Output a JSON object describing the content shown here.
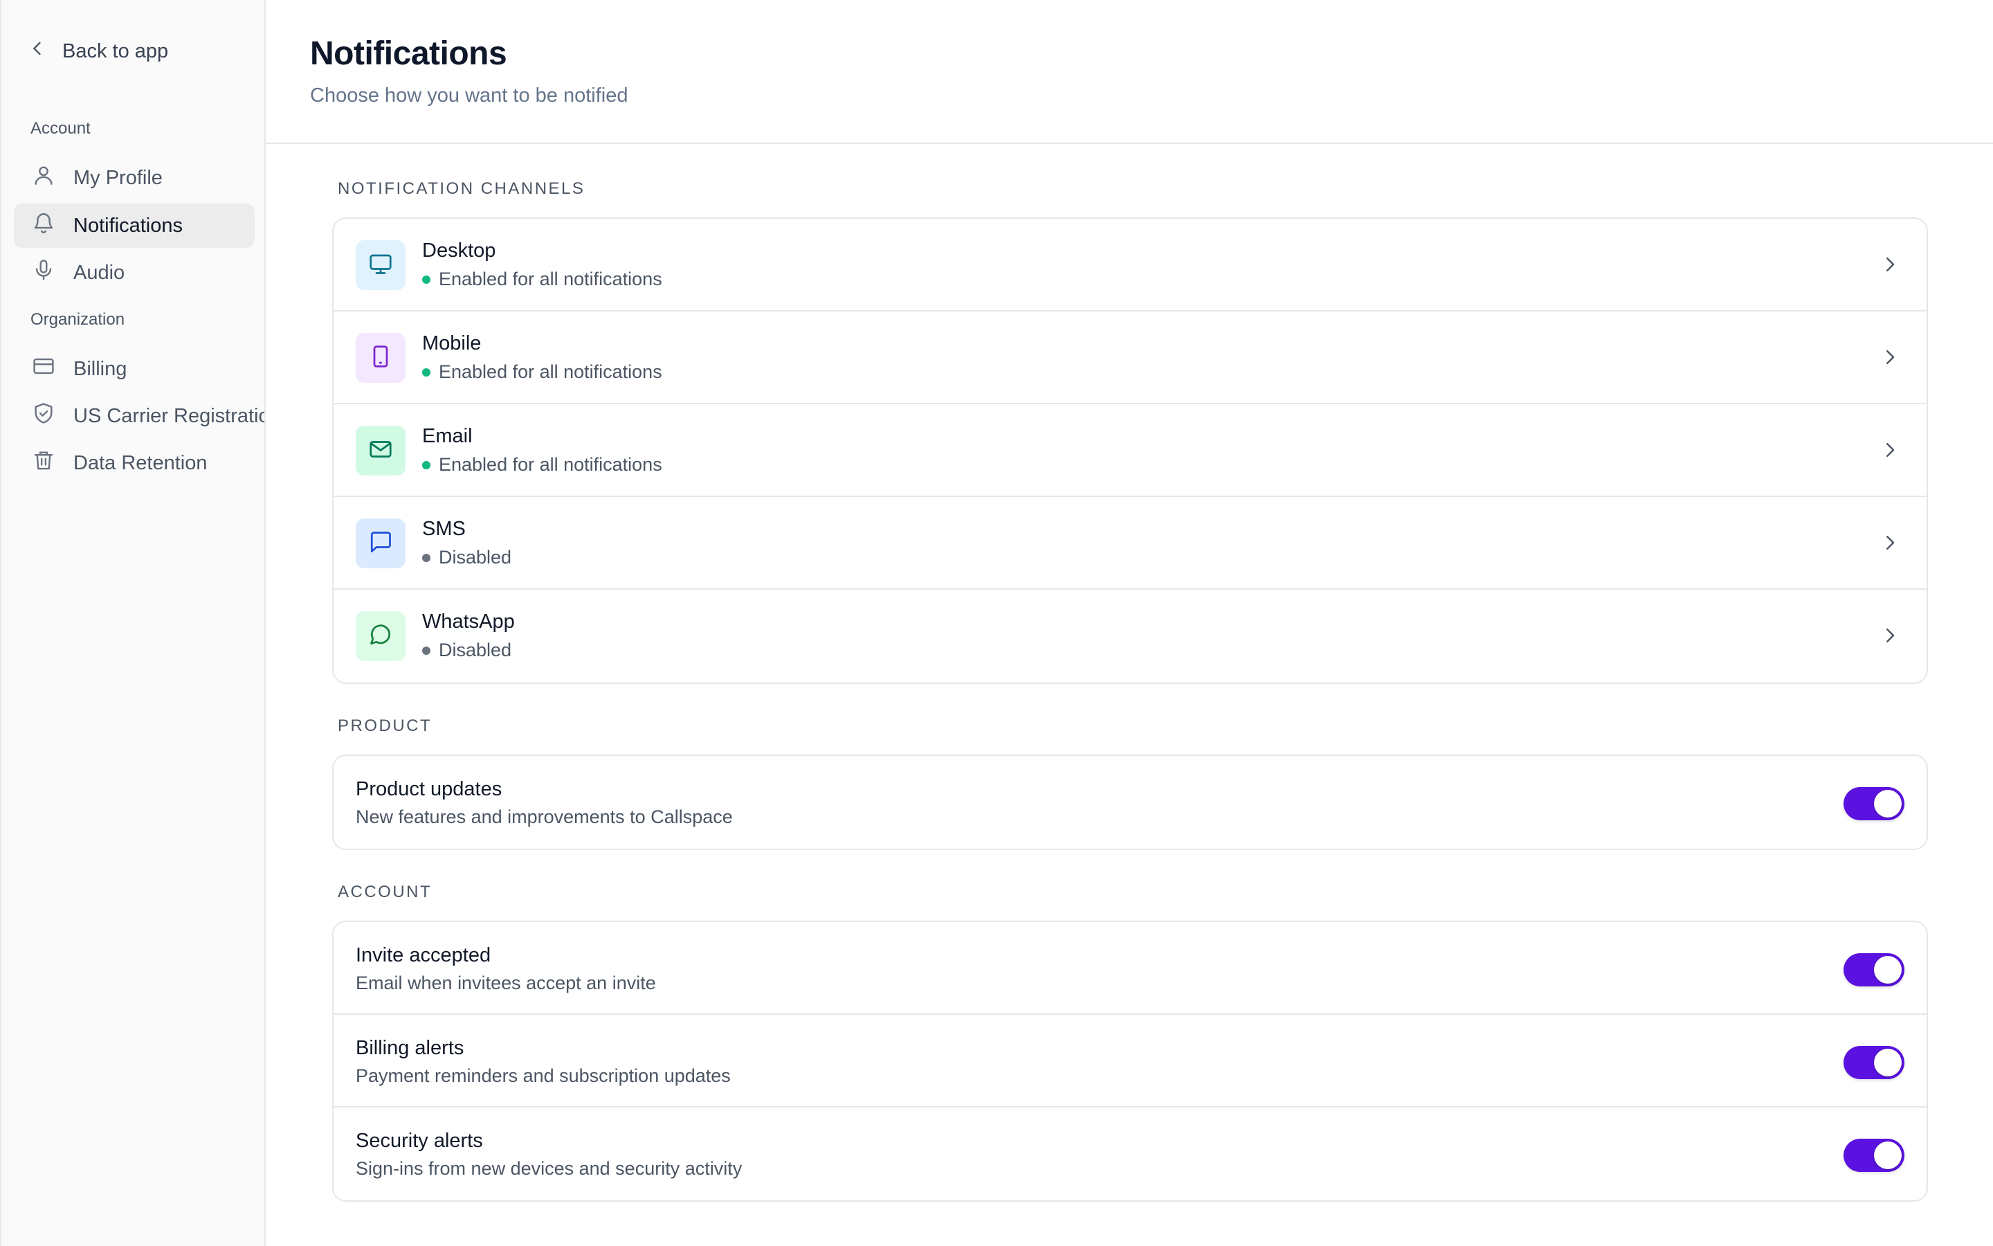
{
  "sidebar": {
    "back_label": "Back to app",
    "account_heading": "Account",
    "organization_heading": "Organization",
    "account_items": [
      {
        "label": "My Profile",
        "icon": "user-icon",
        "active": false
      },
      {
        "label": "Notifications",
        "icon": "bell-icon",
        "active": true
      },
      {
        "label": "Audio",
        "icon": "microphone-icon",
        "active": false
      }
    ],
    "organization_items": [
      {
        "label": "Billing",
        "icon": "credit-card-icon"
      },
      {
        "label": "US Carrier Registration",
        "icon": "shield-check-icon"
      },
      {
        "label": "Data Retention",
        "icon": "trash-icon"
      }
    ]
  },
  "header": {
    "title": "Notifications",
    "subtitle": "Choose how you want to be notified"
  },
  "channels": {
    "heading": "Notification channels",
    "items": [
      {
        "name": "Desktop",
        "status": "Enabled for all notifications",
        "enabled": true,
        "icon": "monitor-icon",
        "icon_color": "#0e7490",
        "icon_bg": "#e0f2fe"
      },
      {
        "name": "Mobile",
        "status": "Enabled for all notifications",
        "enabled": true,
        "icon": "phone-icon",
        "icon_color": "#7e22ce",
        "icon_bg": "#f3e8ff"
      },
      {
        "name": "Email",
        "status": "Enabled for all notifications",
        "enabled": true,
        "icon": "mail-icon",
        "icon_color": "#047857",
        "icon_bg": "#d1fae5"
      },
      {
        "name": "SMS",
        "status": "Disabled",
        "enabled": false,
        "icon": "message-square-icon",
        "icon_color": "#1d4ed8",
        "icon_bg": "#dbeafe"
      },
      {
        "name": "WhatsApp",
        "status": "Disabled",
        "enabled": false,
        "icon": "message-circle-icon",
        "icon_color": "#15803d",
        "icon_bg": "#dcfce7"
      }
    ]
  },
  "product": {
    "heading": "Product",
    "items": [
      {
        "title": "Product updates",
        "description": "New features and improvements to Callspace",
        "on": true
      }
    ]
  },
  "account": {
    "heading": "Account",
    "items": [
      {
        "title": "Invite accepted",
        "description": "Email when invitees accept an invite",
        "on": true
      },
      {
        "title": "Billing alerts",
        "description": "Payment reminders and subscription updates",
        "on": true
      },
      {
        "title": "Security alerts",
        "description": "Sign-ins from new devices and security activity",
        "on": true
      }
    ]
  },
  "colors": {
    "accent": "#5b12e0",
    "enabled_dot": "#10b981",
    "disabled_dot": "#6b7280"
  }
}
